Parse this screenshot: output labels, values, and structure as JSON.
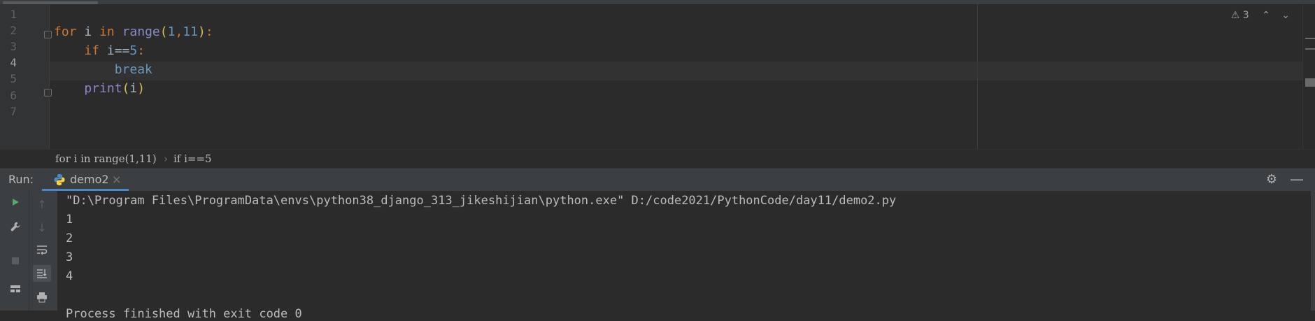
{
  "editor": {
    "line_numbers": [
      "1",
      "2",
      "3",
      "4",
      "5",
      "6",
      "7"
    ],
    "warnings_count": "3",
    "code": {
      "line2": {
        "for": "for",
        "var": " i ",
        "in": "in",
        "sp": " ",
        "range": "range",
        "lp": "(",
        "n1": "1",
        "comma": ",",
        "n2": "11",
        "rp": ")",
        "colon": ":"
      },
      "line3": {
        "indent": "    ",
        "if": "if",
        "expr": " i==",
        "five": "5",
        "colon": ":"
      },
      "line4": {
        "indent": "        ",
        "break": "break"
      },
      "line5": {
        "indent": "    ",
        "print": "print",
        "lp": "(",
        "arg": "i",
        "rp": ")"
      }
    }
  },
  "breadcrumbs": {
    "item1": "for i in range(1,11)",
    "sep": "›",
    "item2": "if i==5"
  },
  "run_panel": {
    "label": "Run:",
    "tab_label": "demo2",
    "tab_close": "×",
    "output_lines": [
      "\"D:\\Program Files\\ProgramData\\envs\\python38_django_313_jikeshijian\\python.exe\" D:/code2021/PythonCode/day11/demo2.py",
      "1",
      "2",
      "3",
      "4",
      "",
      "Process finished with exit code 0"
    ]
  },
  "icons": {
    "warning": "⚠",
    "up": "⌃",
    "down": "⌄",
    "gear": "⚙",
    "minimize": "—",
    "run": "▶",
    "wrench": "🔧",
    "stop": "■",
    "layout": "▤",
    "arrow_up": "↑",
    "arrow_down": "↓",
    "wrap": "⤶",
    "scroll_end": "⇊",
    "print": "⎙"
  },
  "colors": {
    "accent": "#4a88c7",
    "run_green": "#59a869"
  }
}
